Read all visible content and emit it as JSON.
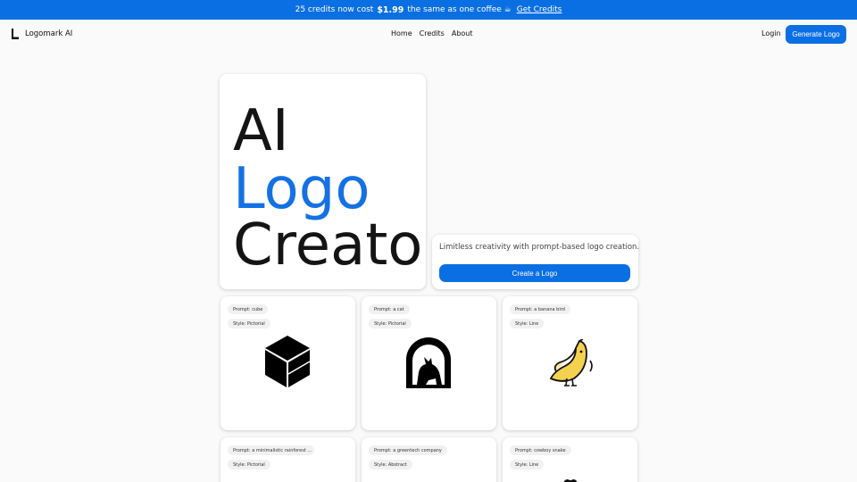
{
  "banner": {
    "text_before": "25 credits now cost",
    "price": "$1.99",
    "text_after": "the same as one coffee ☕",
    "cta": "Get Credits"
  },
  "nav": {
    "brand": "Logomark AI",
    "links": [
      "Home",
      "Credits",
      "About"
    ],
    "login": "Login",
    "generate": "Generate Logo"
  },
  "hero": {
    "line1": "AI",
    "line2": "Logo",
    "line3": "Creator",
    "accent_color": "#1471e4"
  },
  "side": {
    "tagline": "Limitless creativity with prompt-based logo creation.",
    "button": "Create a Logo"
  },
  "cards": [
    {
      "prompt": "Prompt: cube",
      "style": "Style: Pictorial",
      "icon": "cube-icon"
    },
    {
      "prompt": "Prompt: a cat",
      "style": "Style: Pictorial",
      "icon": "cat-icon"
    },
    {
      "prompt": "Prompt: a banana bird",
      "style": "Style: Line",
      "icon": "banana-bird-icon"
    },
    {
      "prompt": "Prompt: a minimalistic rainforest ...",
      "style": "Style: Pictorial",
      "icon": ""
    },
    {
      "prompt": "Prompt: a greentech company",
      "style": "Style: Abstract",
      "icon": ""
    },
    {
      "prompt": "Prompt: cowboy snake",
      "style": "Style: Line",
      "icon": "snake-icon"
    }
  ],
  "colors": {
    "primary": "#0b6fe4"
  }
}
